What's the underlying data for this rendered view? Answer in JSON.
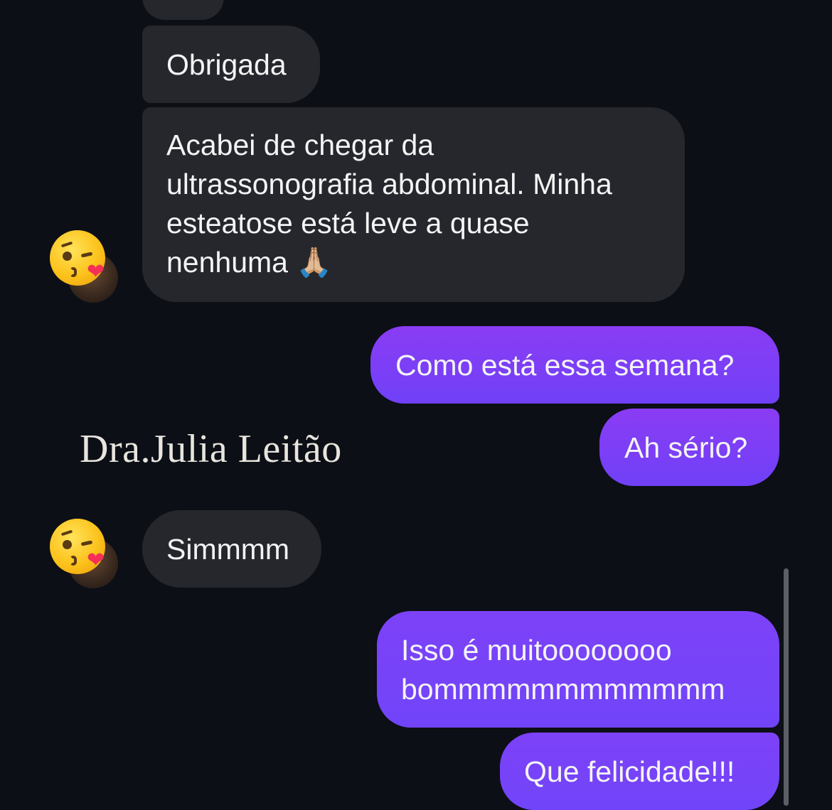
{
  "conversation": {
    "messages": [
      {
        "id": "m1",
        "direction": "received",
        "text": "Obrigada"
      },
      {
        "id": "m2",
        "direction": "received",
        "lines": [
          "Acabei de chegar da",
          "ultrassonografia abdominal. Minha",
          "esteatose está leve a quase",
          "nenhuma 🙏🏼"
        ]
      },
      {
        "id": "m3",
        "direction": "sent",
        "text": "Como está essa semana?"
      },
      {
        "id": "m4",
        "direction": "sent",
        "text": "Ah sério?"
      },
      {
        "id": "m5",
        "direction": "received",
        "text": "Simmmm"
      },
      {
        "id": "m6",
        "direction": "sent",
        "lines": [
          "Isso é muitoooooooo",
          "bommmmmmmmmmmm"
        ]
      },
      {
        "id": "m7",
        "direction": "sent",
        "text": "Que felicidade!!!"
      }
    ],
    "reactions": {
      "emoji_name": "face-blowing-a-kiss",
      "emoji": "😘"
    }
  },
  "watermark": {
    "text": "Dra.Julia Leitão"
  },
  "colors": {
    "background": "#0c0f16",
    "received_bubble": "#26272c",
    "sent_bubble": "#7a3ff6",
    "text": "#f4f4f6"
  }
}
